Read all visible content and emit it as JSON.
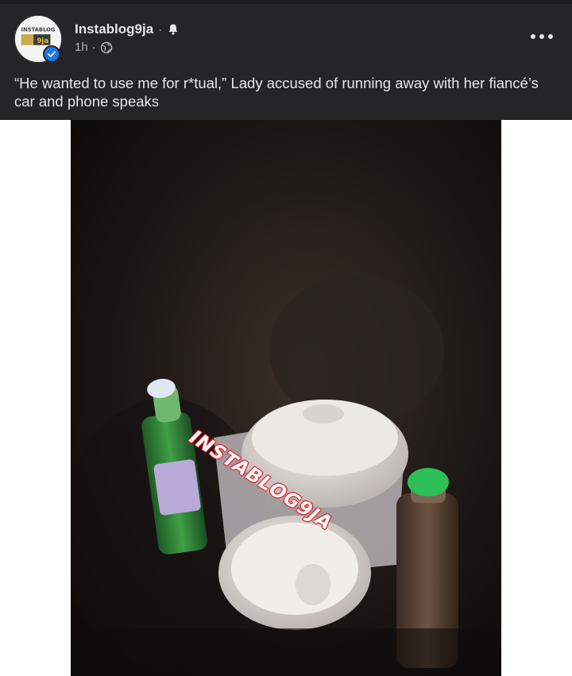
{
  "post": {
    "page_name": "Instablog9ja",
    "name_separator": "·",
    "timestamp": "1h",
    "meta_separator": "·",
    "caption": "“He wanted to use me for r*tual,” Lady accused of running away with her fiancé’s car and phone speaks",
    "avatar_icon": "instablog9ja-logo",
    "verified_icon": "verified-badge-icon",
    "privacy_icon": "globe-icon",
    "follow_icon": "bell-icon",
    "menu_icon": "more-options-icon"
  },
  "media": {
    "watermark": "INSTABLOG9JA",
    "logo_text": "INSTABLOG 9ja"
  },
  "colors": {
    "header_bg": "#242526",
    "text_primary": "#e4e6eb",
    "text_secondary": "#b0b3b8",
    "verified_blue": "#1877f2",
    "watermark_red": "#e0262a"
  }
}
